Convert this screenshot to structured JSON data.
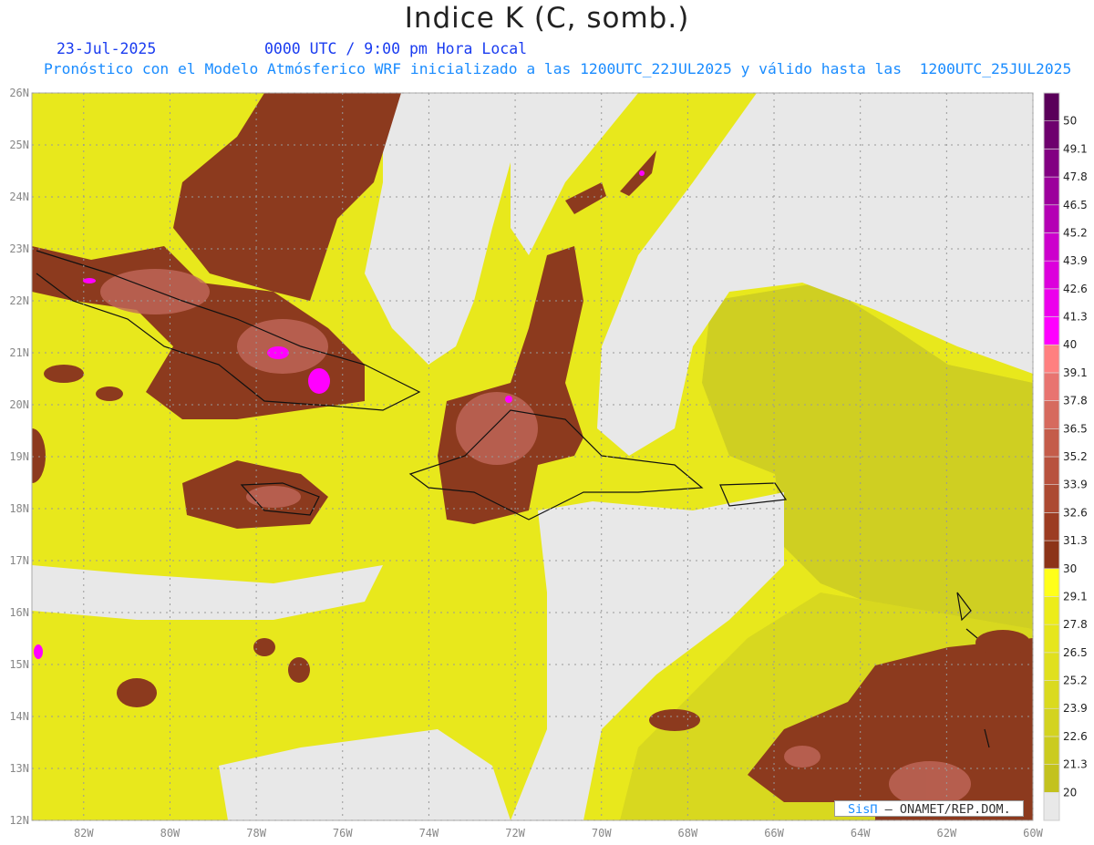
{
  "title": "Indice K (C, somb.)",
  "date": "23-Jul-2025",
  "time": "0000 UTC / 9:00 pm Hora Local",
  "info": "Pronóstico con el Modelo Atmósferico WRF inicializado a las 1200UTC_22JUL2025 y válido hasta las  1200UTC_25JUL2025",
  "credit": {
    "logo": "SisΠ",
    "text": " – ONAMET/REP.DOM."
  },
  "map": {
    "lon_range": [
      -83.2,
      -60
    ],
    "lat_range": [
      12,
      26
    ],
    "lon_ticks": [
      "82W",
      "80W",
      "78W",
      "76W",
      "74W",
      "72W",
      "70W",
      "68W",
      "66W",
      "64W",
      "62W",
      "60W"
    ],
    "lat_ticks": [
      "12N",
      "13N",
      "14N",
      "15N",
      "16N",
      "17N",
      "18N",
      "19N",
      "20N",
      "21N",
      "22N",
      "23N",
      "24N",
      "25N",
      "26N"
    ]
  },
  "colorbar": {
    "labels": [
      "20",
      "21.3",
      "22.6",
      "23.9",
      "25.2",
      "26.5",
      "27.8",
      "29.1",
      "30",
      "31.3",
      "32.6",
      "33.9",
      "35.2",
      "36.5",
      "37.8",
      "39.1",
      "40",
      "41.3",
      "42.6",
      "43.9",
      "45.2",
      "46.5",
      "47.8",
      "49.1",
      "50"
    ],
    "colors": [
      "#e8e8e8",
      "#c3c21e",
      "#cbcb1f",
      "#d3d320",
      "#dada1f",
      "#e0e01e",
      "#e6e61c",
      "#ecec1a",
      "#ffff1a",
      "#8c3418",
      "#9c3c22",
      "#ac4a32",
      "#b8523e",
      "#c45c4a",
      "#d66a5e",
      "#e87470",
      "#ff8080",
      "#ff00ff",
      "#ec00ec",
      "#dc00dc",
      "#cc00cc",
      "#b400b4",
      "#9c009c",
      "#820082",
      "#6e006e",
      "#5a005a"
    ]
  }
}
